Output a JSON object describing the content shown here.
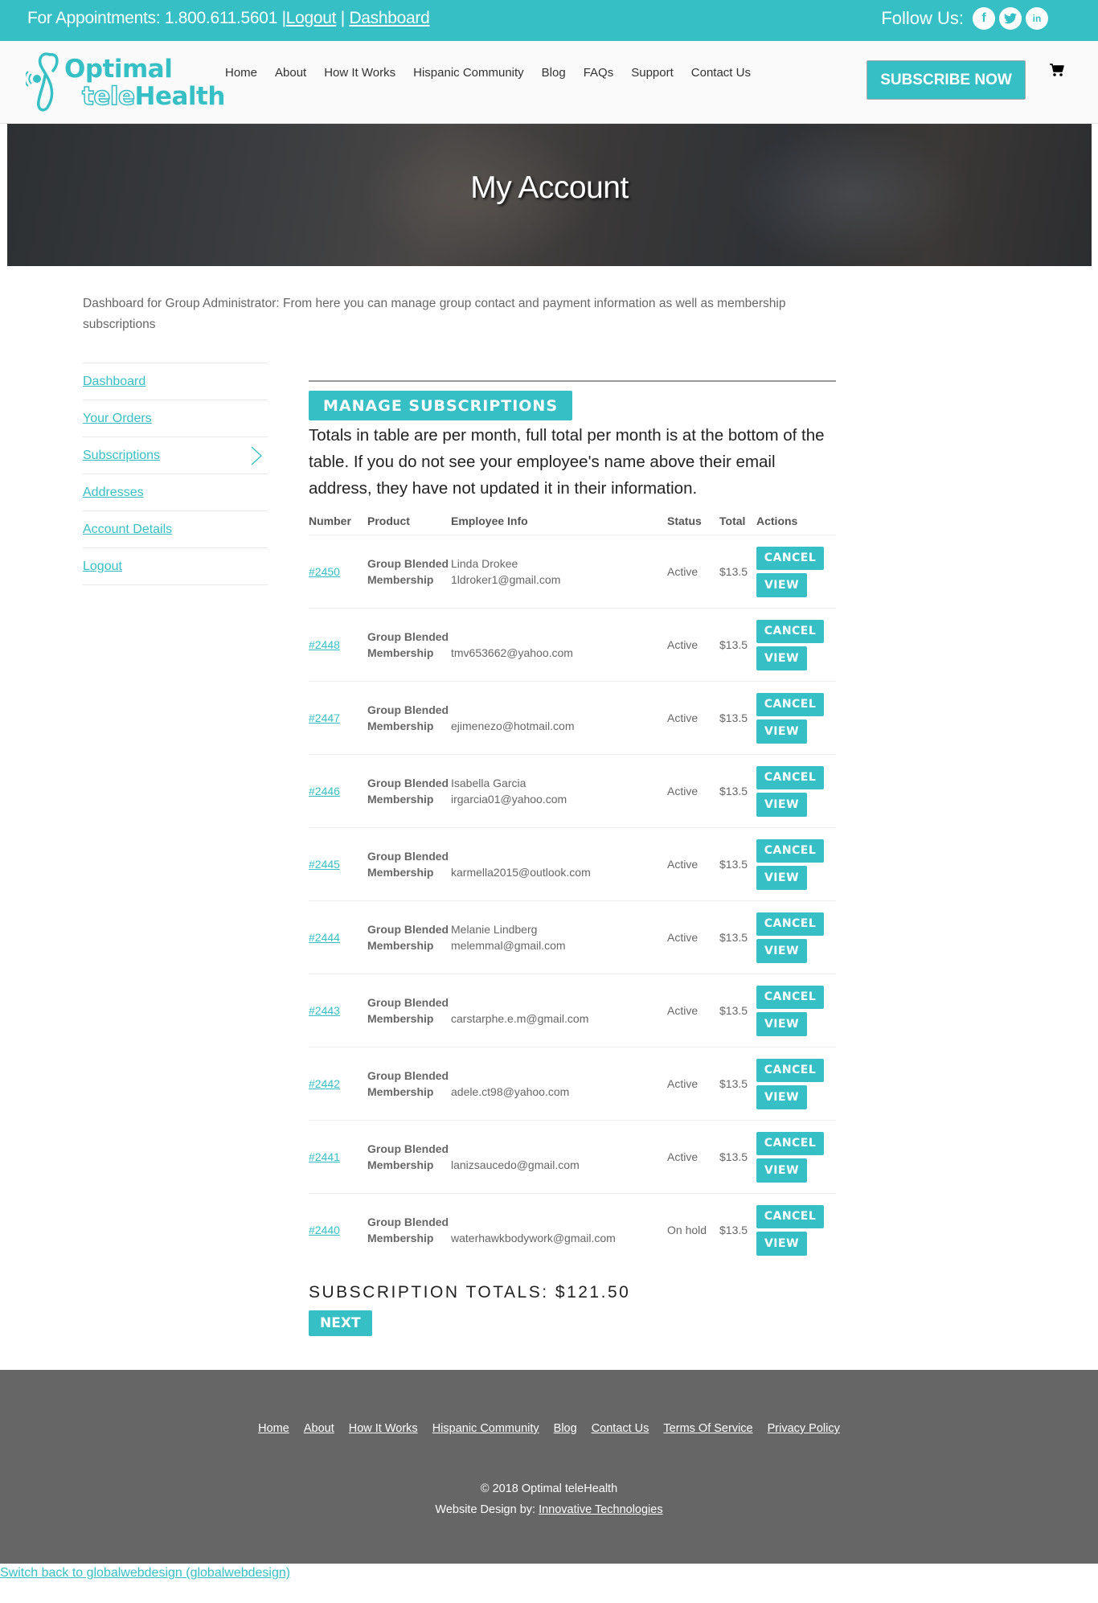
{
  "topbar": {
    "appointments_label": "For Appointments: 1.800.611.5601 |",
    "logout_link": "Logout",
    "separator": " | ",
    "dashboard_link": "Dashboard",
    "follow_label": "Follow Us:",
    "social": [
      {
        "name": "facebook-icon",
        "glyph": "f"
      },
      {
        "name": "twitter-icon",
        "glyph": "t"
      },
      {
        "name": "linkedin-icon",
        "glyph": "in"
      }
    ]
  },
  "header": {
    "logo_line1": "Optimal",
    "logo_line2_outline": "tele",
    "logo_line2_solid": "Health",
    "nav": [
      "Home",
      "About",
      "How It Works",
      "Hispanic Community",
      "Blog",
      "FAQs",
      "Support",
      "Contact Us"
    ],
    "subscribe_label": "SUBSCRIBE NOW",
    "cart_icon": "shopping-cart-icon"
  },
  "hero": {
    "title": "My Account"
  },
  "intro": "Dashboard for Group Administrator: From here you can manage group contact and payment information as well as membership subscriptions",
  "sidebar": {
    "items": [
      {
        "label": "Dashboard",
        "active": false
      },
      {
        "label": "Your Orders",
        "active": false
      },
      {
        "label": "Subscriptions",
        "active": true
      },
      {
        "label": "Addresses",
        "active": false
      },
      {
        "label": "Account Details",
        "active": false
      },
      {
        "label": "Logout",
        "active": false
      }
    ]
  },
  "main": {
    "heading": "MANAGE SUBSCRIPTIONS",
    "note": "Totals in table are per month, full total per month is at the bottom of the table. If you do not see your employee's name above their email address, they have not updated it in their information.",
    "columns": [
      "Number",
      "Product",
      "Employee Info",
      "Status",
      "Total",
      "Actions"
    ],
    "cancel_label": "CANCEL",
    "view_label": "VIEW",
    "rows": [
      {
        "number": "#2450",
        "product_line1": "Group Blended",
        "product_line2": "Membership",
        "name": "Linda Drokee",
        "email": "1ldroker1@gmail.com",
        "status": "Active",
        "total": "$13.5"
      },
      {
        "number": "#2448",
        "product_line1": "Group Blended",
        "product_line2": "Membership",
        "name": "",
        "email": "tmv653662@yahoo.com",
        "status": "Active",
        "total": "$13.5"
      },
      {
        "number": "#2447",
        "product_line1": "Group Blended",
        "product_line2": "Membership",
        "name": "",
        "email": "ejimenezo@hotmail.com",
        "status": "Active",
        "total": "$13.5"
      },
      {
        "number": "#2446",
        "product_line1": "Group Blended",
        "product_line2": "Membership",
        "name": "Isabella Garcia",
        "email": "irgarcia01@yahoo.com",
        "status": "Active",
        "total": "$13.5"
      },
      {
        "number": "#2445",
        "product_line1": "Group Blended",
        "product_line2": "Membership",
        "name": "",
        "email": "karmella2015@outlook.com",
        "status": "Active",
        "total": "$13.5"
      },
      {
        "number": "#2444",
        "product_line1": "Group Blended",
        "product_line2": "Membership",
        "name": "Melanie Lindberg",
        "email": "melemmal@gmail.com",
        "status": "Active",
        "total": "$13.5"
      },
      {
        "number": "#2443",
        "product_line1": "Group Blended",
        "product_line2": "Membership",
        "name": "",
        "email": "carstarphe.e.m@gmail.com",
        "status": "Active",
        "total": "$13.5"
      },
      {
        "number": "#2442",
        "product_line1": "Group Blended",
        "product_line2": "Membership",
        "name": "",
        "email": "adele.ct98@yahoo.com",
        "status": "Active",
        "total": "$13.5"
      },
      {
        "number": "#2441",
        "product_line1": "Group Blended",
        "product_line2": "Membership",
        "name": "",
        "email": "lanizsaucedo@gmail.com",
        "status": "Active",
        "total": "$13.5"
      },
      {
        "number": "#2440",
        "product_line1": "Group Blended",
        "product_line2": "Membership",
        "name": "",
        "email": "waterhawkbodywork@gmail.com",
        "status": "On hold",
        "total": "$13.5"
      }
    ],
    "totals_label": "SUBSCRIPTION TOTALS: $121.50",
    "next_label": "NEXT"
  },
  "footer": {
    "links": [
      "Home",
      "About",
      "How It Works",
      "Hispanic Community",
      "Blog",
      "Contact Us",
      "Terms Of Service",
      "Privacy Policy"
    ],
    "copyright": "© 2018 Optimal teleHealth",
    "design_prefix": "Website Design by: ",
    "design_link": "Innovative Technologies"
  },
  "switch_back": "Switch back to globalwebdesign (globalwebdesign)",
  "colors": {
    "accent": "#36bfc4",
    "footer_bg": "#666666",
    "text": "#666666"
  }
}
